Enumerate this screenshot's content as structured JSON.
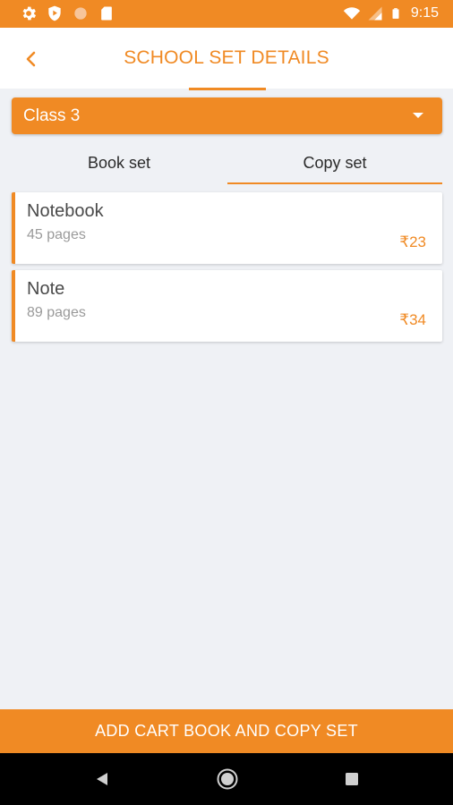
{
  "status_bar": {
    "time": "9:15",
    "left_icons": [
      "gear-icon",
      "shield-play-icon",
      "circle-icon",
      "sd-card-icon"
    ],
    "right_icons": [
      "wifi-icon",
      "signal-icon",
      "battery-icon"
    ]
  },
  "header": {
    "title": "SCHOOL SET DETAILS",
    "back_icon": "chevron-left-icon"
  },
  "class_select": {
    "selected": "Class 3",
    "icon": "caret-down-icon"
  },
  "tabs": [
    {
      "label": "Book set",
      "active": false
    },
    {
      "label": "Copy set",
      "active": true
    }
  ],
  "items": [
    {
      "name": "Notebook",
      "pages": "45 pages",
      "price": "₹23"
    },
    {
      "name": "Note",
      "pages": "89 pages",
      "price": "₹34"
    }
  ],
  "footer": {
    "button_label": "ADD CART BOOK AND COPY SET"
  },
  "nav": {
    "icons": [
      "nav-back-icon",
      "nav-home-icon",
      "nav-recents-icon"
    ]
  },
  "colors": {
    "accent": "#f08a24",
    "background": "#eff1f5",
    "card": "#ffffff",
    "nav_bar": "#000000"
  }
}
